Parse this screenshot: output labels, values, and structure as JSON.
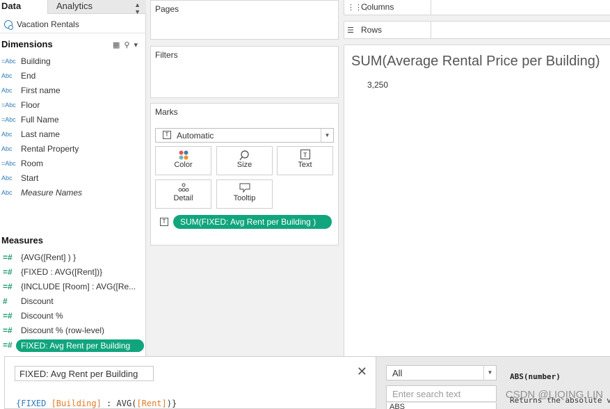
{
  "data_pane": {
    "tab_data": "Data",
    "tab_analytics": "Analytics",
    "datasource": "Vacation Rentals",
    "dimensions_title": "Dimensions",
    "dimensions": [
      {
        "type": "=Abc",
        "label": "Building"
      },
      {
        "type": "Abc",
        "label": "End"
      },
      {
        "type": "Abc",
        "label": "First name"
      },
      {
        "type": "=Abc",
        "label": "Floor"
      },
      {
        "type": "=Abc",
        "label": "Full Name"
      },
      {
        "type": "Abc",
        "label": "Last name"
      },
      {
        "type": "Abc",
        "label": "Rental Property"
      },
      {
        "type": "=Abc",
        "label": "Room"
      },
      {
        "type": "Abc",
        "label": "Start"
      },
      {
        "type": "Abc",
        "label": "Measure Names"
      }
    ],
    "measures_title": "Measures",
    "measures": [
      {
        "label": "{AVG([Rent] ) }"
      },
      {
        "label": "{FIXED : AVG([Rent])}"
      },
      {
        "label": "{INCLUDE [Room] : AVG([Re..."
      },
      {
        "label": "Discount"
      },
      {
        "label": "Discount %"
      },
      {
        "label": "Discount % (row-level)"
      },
      {
        "label": "FIXED: Avg Rent per Building"
      }
    ]
  },
  "shelves": {
    "pages": "Pages",
    "filters": "Filters",
    "marks": "Marks",
    "columns": "Columns",
    "rows": "Rows"
  },
  "marks": {
    "type": "Automatic",
    "buttons": [
      {
        "label": "Color",
        "icon": "color-dots-icon"
      },
      {
        "label": "Size",
        "icon": "size-icon"
      },
      {
        "label": "Text",
        "icon": "text-icon"
      },
      {
        "label": "Detail",
        "icon": "detail-icon"
      },
      {
        "label": "Tooltip",
        "icon": "tooltip-icon"
      }
    ],
    "pill": "SUM(FIXED: Avg Rent per Building  )"
  },
  "viz": {
    "title": "SUM(Average Rental Price per Building)",
    "value": "3,250"
  },
  "calc_editor": {
    "name": "FIXED: Avg Rent per Building",
    "formula_open": "{FIXED ",
    "formula_field1": "[Building]",
    "formula_mid": " : AVG(",
    "formula_field2": "[Rent]",
    "formula_close": ")}"
  },
  "functions": {
    "filter": "All",
    "search_placeholder": "Enter search text",
    "first_item": "ABS",
    "signature": "ABS(number)",
    "description": "Returns the absolute value of the given number."
  },
  "watermark": "CSDN @LIQING LIN",
  "colors": {
    "pill_green": "#10a57d",
    "dimension_blue": "#2e7ab8",
    "measure_green": "#1b9a72"
  }
}
